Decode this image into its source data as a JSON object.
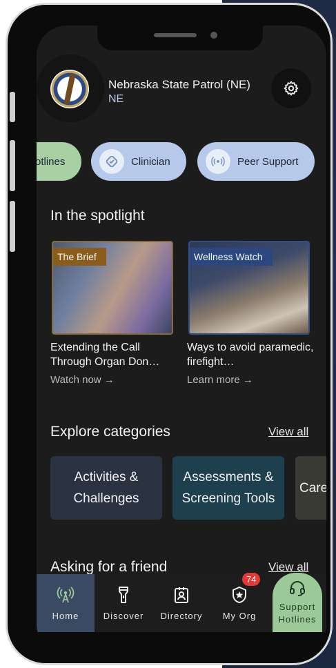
{
  "header": {
    "org_name": "Nebraska State Patrol (NE)",
    "org_sub": "NE"
  },
  "chips": [
    {
      "label": "otlines",
      "icon": "hotline-icon"
    },
    {
      "label": "Clinician",
      "icon": "clinician-icon"
    },
    {
      "label": "Peer Support",
      "icon": "peer-support-icon"
    }
  ],
  "spotlight": {
    "title": "In the spotlight",
    "cards": [
      {
        "tag": "The Brief",
        "title": "Extending the Call Through Organ Don…",
        "link": "Watch now →"
      },
      {
        "tag": "Wellness Watch",
        "title": "Ways to avoid paramedic, firefight…",
        "link": "Learn more →"
      }
    ]
  },
  "categories": {
    "title": "Explore categories",
    "view_all": "View all",
    "items": [
      "Activities & Challenges",
      "Assessments & Screening Tools",
      "Care"
    ]
  },
  "friend": {
    "title": "Asking for a friend",
    "view_all": "View all"
  },
  "nav": {
    "home": "Home",
    "discover": "Discover",
    "directory": "Directory",
    "my_org": "My Org",
    "my_org_count": "74",
    "support": "Support Hotlines"
  },
  "colors": {
    "accent_green": "#9cc99a",
    "chip_blue": "#b7c9ea",
    "badge_red": "#e53935"
  }
}
